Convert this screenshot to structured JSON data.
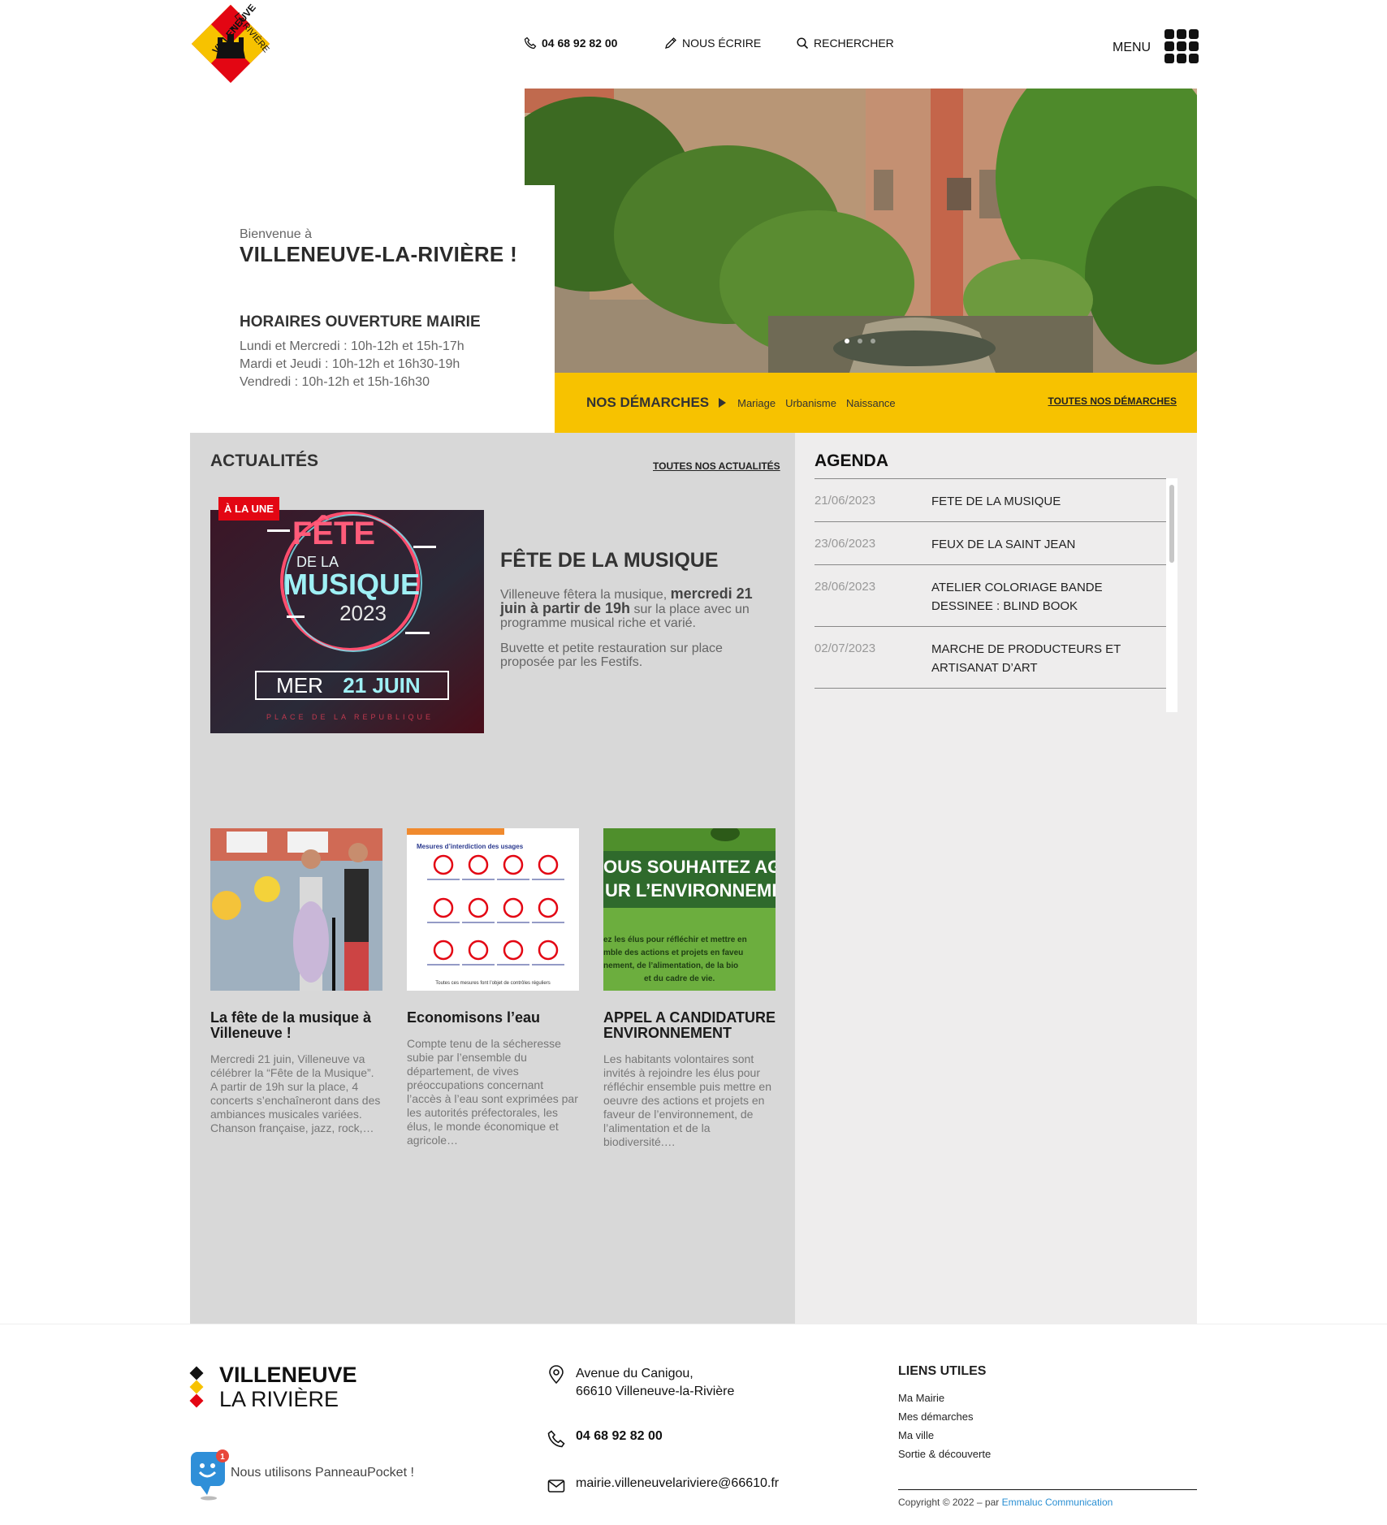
{
  "header": {
    "logo_text_1": "VILLENEUVE",
    "logo_text_2": "LA RIVIÈRE",
    "phone": "04 68 92 82 00",
    "write": "NOUS ÉCRIRE",
    "search": "RECHERCHER",
    "menu": "MENU"
  },
  "hero": {
    "welcome": "Bienvenue à",
    "town": "VILLENEUVE-LA-RIVIÈRE !",
    "hours_title": "HORAIRES OUVERTURE MAIRIE",
    "hours": [
      "Lundi et Mercredi : 10h-12h et 15h-17h",
      "Mardi et Jeudi : 10h-12h et 16h30-19h",
      "Vendredi : 10h-12h et 15h-16h30"
    ],
    "slides": 3,
    "active_slide": 1
  },
  "demarches": {
    "title": "NOS DÉMARCHES",
    "links": [
      "Mariage",
      "Urbanisme",
      "Naissance"
    ],
    "all": "TOUTES NOS DÉMARCHES"
  },
  "news": {
    "title": "ACTUALITÉS",
    "all": "TOUTES NOS ACTUALITÉS",
    "featured": {
      "badge": "À LA UNE",
      "poster_line1": "FÊTE",
      "poster_line2": "DE LA",
      "poster_line3": "MUSIQUE",
      "poster_year": "2023",
      "poster_date_a": "MER",
      "poster_date_b": "21 JUIN",
      "poster_place": "PLACE DE LA REPUBLIQUE",
      "title": "FÊTE DE LA MUSIQUE",
      "p1_a": "Villeneuve fêtera la musique,",
      "p1_b": "mercredi 21 juin à partir de 19h",
      "p1_c": "sur la place avec un programme musical riche et varié.",
      "p2": "Buvette et petite restauration sur place proposée par les Festifs."
    },
    "cards": [
      {
        "title": "La fête de la musique à Villeneuve !",
        "text": "Mercredi 21 juin, Villeneuve va célébrer la “Fête de la Musique”. A partir de 19h sur la place, 4 concerts s’enchaîneront dans des ambiances musicales variées. Chanson française, jazz, rock,…"
      },
      {
        "title": "Economisons l’eau",
        "text": "Compte tenu de la sécheresse subie par l’ensemble du département, de vives préoccupations concernant l’accès à l’eau sont exprimées par les autorités préfectorales, les élus, le monde économique et agricole…",
        "img_heading": "Mesures d’interdiction des usages",
        "img_footer": "Toutes ces mesures font l’objet de contrôles réguliers"
      },
      {
        "title": "APPEL A CANDIDATURE ENVIRONNEMENT",
        "text": "Les habitants volontaires sont invités à rejoindre les élus pour réfléchir ensemble puis mettre en oeuvre des actions et projets en faveur de l’environnement, de l’alimentation et de la biodiversité.…",
        "img_line1": "OUS SOUHAITEZ AG",
        "img_line2": "UR L’ENVIRONNEMEI",
        "img_small1": "ez les élus pour réfléchir et mettre en",
        "img_small2": "mble des actions et projets en faveu",
        "img_small3": "nement, de l’alimentation, de la bio",
        "img_small4": "et du cadre de vie."
      }
    ]
  },
  "agenda": {
    "title": "AGENDA",
    "events": [
      {
        "date": "21/06/2023",
        "label": "FETE DE LA MUSIQUE"
      },
      {
        "date": "23/06/2023",
        "label": "FEUX DE LA SAINT JEAN"
      },
      {
        "date": "28/06/2023",
        "label": "ATELIER COLORIAGE BANDE DESSINEE : BLIND BOOK"
      },
      {
        "date": "02/07/2023",
        "label": "MARCHE DE PRODUCTEURS ET ARTISANAT D’ART"
      }
    ]
  },
  "footer": {
    "name1": "VILLENEUVE",
    "name2": "LA RIVIÈRE",
    "panneau_badge": "1",
    "panneau_text": "Nous utilisons PanneauPocket !",
    "address1": "Avenue du Canigou,",
    "address2": "66610 Villeneuve-la-Rivière",
    "phone": "04 68 92 82 00",
    "email": "mairie.villeneuvelariviere@66610.fr",
    "links_title": "LIENS UTILES",
    "links": [
      "Ma Mairie",
      "Mes démarches",
      "Ma ville",
      "Sortie & découverte"
    ],
    "copyright": "Copyright © 2022 – par",
    "copyright_brand": "Emmaluc Communication"
  },
  "colors": {
    "yellow": "#f7c200",
    "red": "#e30613",
    "news_bg": "#d8d8d8",
    "agenda_bg": "#eeeded"
  }
}
